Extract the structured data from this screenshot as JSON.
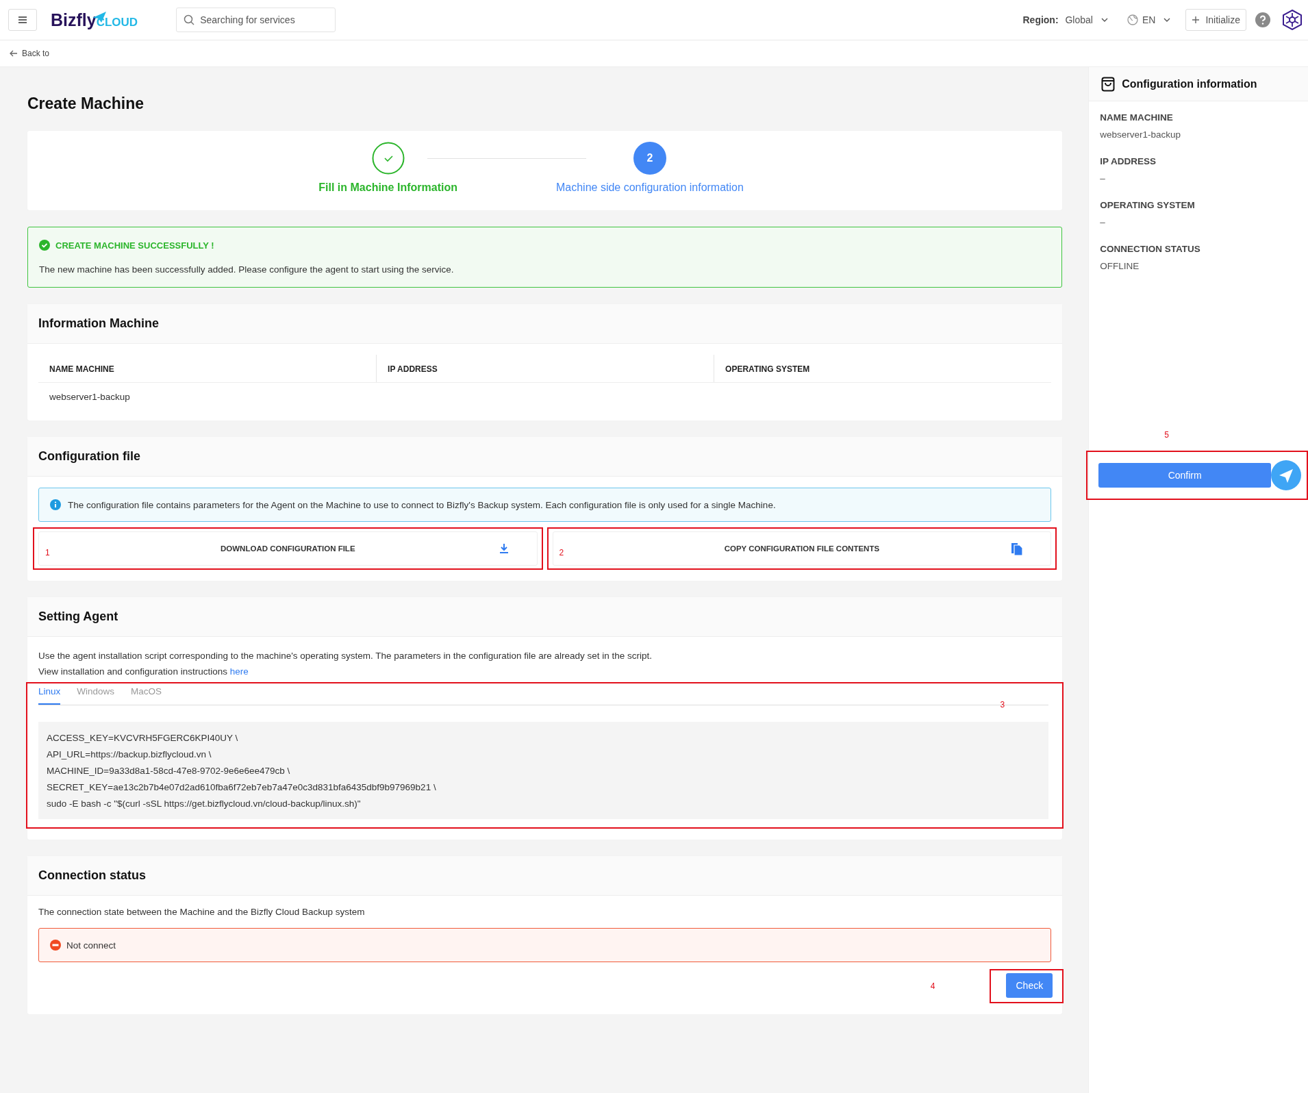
{
  "header": {
    "logo": {
      "main": "Bizfly",
      "accent": "CLOUD"
    },
    "search": {
      "placeholder": "Searching for services"
    },
    "region": {
      "label": "Region:",
      "value": "Global"
    },
    "language": "EN",
    "initialize_button": "Initialize"
  },
  "back_link": "Back to",
  "page_title": "Create Machine",
  "stepper": [
    {
      "label": "Fill in Machine Information",
      "completed": true,
      "selected": false
    },
    {
      "label": "Machine side configuration information",
      "completed": false,
      "selected": true,
      "number": "2"
    }
  ],
  "success_alert": {
    "title": "CREATE MACHINE SUCCESSFULLY !",
    "message": "The new machine has been successfully added. Please configure the agent to start using the service."
  },
  "information_machine": {
    "title": "Information Machine",
    "columns": [
      "NAME MACHINE",
      "IP ADDRESS",
      "OPERATING SYSTEM"
    ],
    "rows": [
      [
        "webserver1-backup",
        "",
        ""
      ]
    ]
  },
  "configuration_file": {
    "title": "Configuration file",
    "info": "The configuration file contains parameters for the Agent on the Machine to use to connect to Bizfly's Backup system. Each configuration file is only used for a single Machine.",
    "buttons": [
      {
        "label": "DOWNLOAD CONFIGURATION FILE",
        "kind": "download",
        "marker": "1"
      },
      {
        "label": "COPY CONFIGURATION FILE CONTENTS",
        "kind": "copy",
        "marker": "2"
      }
    ]
  },
  "setting_agent": {
    "title": "Setting Agent",
    "description": "Use the agent installation script corresponding to the machine's operating system. The parameters in the configuration file are already set in the script.",
    "instructions": "View installation and configuration instructions",
    "instructions_link": "here",
    "marker": "3",
    "tabs": [
      {
        "label": "Linux",
        "selected": true
      },
      {
        "label": "Windows",
        "selected": false
      },
      {
        "label": "MacOS",
        "selected": false
      }
    ],
    "script": [
      "ACCESS_KEY=KVCVRH5FGERC6KPI40UY \\",
      "API_URL=https://backup.bizflycloud.vn \\",
      "MACHINE_ID=9a33d8a1-58cd-47e8-9702-9e6e6ee479cb \\",
      "SECRET_KEY=ae13c2b7b4e07d2ad610fba6f72eb7eb7a47e0c3d831bfa6435dbf9b97969b21 \\",
      "sudo -E bash -c \"$(curl -sSL https://get.bizflycloud.vn/cloud-backup/linux.sh)\""
    ]
  },
  "connection_status": {
    "title": "Connection status",
    "description": "The connection state between the Machine and the Bizfly Cloud Backup system",
    "status": "Not connect",
    "check_button": "Check",
    "marker": "4"
  },
  "sidebar": {
    "title": "Configuration information",
    "fields": [
      {
        "label": "NAME MACHINE",
        "value": "webserver1-backup"
      },
      {
        "label": "IP ADDRESS",
        "value": "–"
      },
      {
        "label": "OPERATING SYSTEM",
        "value": "–"
      },
      {
        "label": "CONNECTION STATUS",
        "value": "OFFLINE"
      }
    ],
    "confirm_button": "Confirm",
    "marker": "5"
  }
}
